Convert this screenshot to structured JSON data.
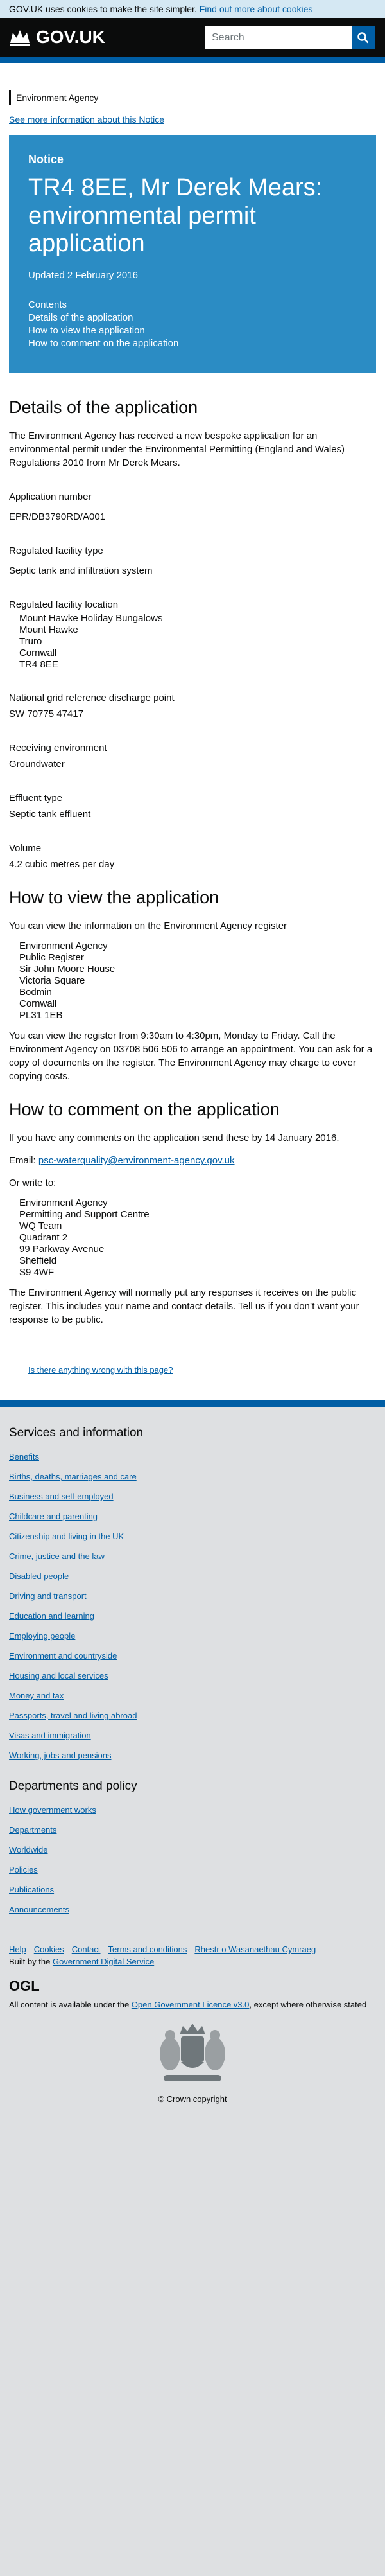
{
  "cookie_banner": {
    "text": "GOV.UK uses cookies to make the site simpler.",
    "link": "Find out more about cookies"
  },
  "header": {
    "logo": "GOV.UK",
    "search_placeholder": "Search"
  },
  "organisation": "Environment Agency",
  "more_info": "See more information about this Notice",
  "hero": {
    "type": "Notice",
    "title": "TR4 8EE, Mr Derek Mears: environmental permit application",
    "updated": "Updated 2 February 2016",
    "contents": [
      "Contents",
      "Details of the application",
      "How to view the application",
      "How to comment on the application"
    ]
  },
  "details": {
    "heading": "Details of the application",
    "intro": "The Environment Agency has received a new bespoke application for an environmental permit under the Environmental Permitting (England and Wales) Regulations 2010 from Mr Derek Mears.",
    "application_number_label": "Application number",
    "application_number": "EPR/DB3790RD/A001",
    "facility_type_label": "Regulated facility type",
    "facility_type": "Septic tank and infiltration system",
    "location_label": "Regulated facility location",
    "location": [
      "Mount Hawke Holiday Bungalows",
      "Mount Hawke",
      "Truro",
      "Cornwall",
      "TR4 8EE"
    ],
    "grid_label": "National grid reference discharge point",
    "grid": "SW 70775 47417",
    "receiving_label": "Receiving environment",
    "receiving": "Groundwater",
    "effluent_label": "Effluent type",
    "effluent": "Septic tank effluent",
    "volume_label": "Volume",
    "volume": "4.2 cubic metres per day"
  },
  "view": {
    "heading": "How to view the application",
    "intro": "You can view the information on the Environment Agency register",
    "address": [
      "Environment Agency",
      "Public Register",
      "Sir John Moore House",
      "Victoria Square",
      "Bodmin",
      "Cornwall",
      "PL31 1EB"
    ],
    "hours": "You can view the register from 9:30am to 4:30pm, Monday to Friday. Call the Environment Agency on 03708 506 506 to arrange an appointment. You can ask for a copy of documents on the register. The Environment Agency may charge to cover copying costs."
  },
  "comment": {
    "heading": "How to comment on the application",
    "intro": "If you have any comments on the application send these by 14 January 2016.",
    "email_label": "Email:",
    "email": "psc-waterquality@environment-agency.gov.uk",
    "write_label": "Or write to:",
    "address": [
      "Environment Agency",
      "Permitting and Support Centre",
      "WQ Team",
      "Quadrant 2",
      "99 Parkway Avenue",
      "Sheffield",
      "S9 4WF"
    ],
    "note": "The Environment Agency will normally put any responses it receives on the public register. This includes your name and contact details. Tell us if you don’t want your response to be public."
  },
  "report": "Is there anything wrong with this page?",
  "footer": {
    "services_heading": "Services and information",
    "services": [
      "Benefits",
      "Births, deaths, marriages and care",
      "Business and self-employed",
      "Childcare and parenting",
      "Citizenship and living in the UK",
      "Crime, justice and the law",
      "Disabled people",
      "Driving and transport",
      "Education and learning",
      "Employing people",
      "Environment and countryside",
      "Housing and local services",
      "Money and tax",
      "Passports, travel and living abroad",
      "Visas and immigration",
      "Working, jobs and pensions"
    ],
    "departments_heading": "Departments and policy",
    "departments": [
      "How government works",
      "Departments",
      "Worldwide",
      "Policies",
      "Publications",
      "Announcements"
    ],
    "meta": [
      "Help",
      "Cookies",
      "Contact",
      "Terms and conditions",
      "Rhestr o Wasanaethau Cymraeg"
    ],
    "built_prefix": "Built by the",
    "built_link": "Government Digital Service",
    "ogl": "OGL",
    "licence_prefix": "All content is available under the",
    "licence_link": "Open Government Licence v3.0",
    "licence_suffix": ", except where otherwise stated",
    "copyright": "© Crown copyright"
  }
}
